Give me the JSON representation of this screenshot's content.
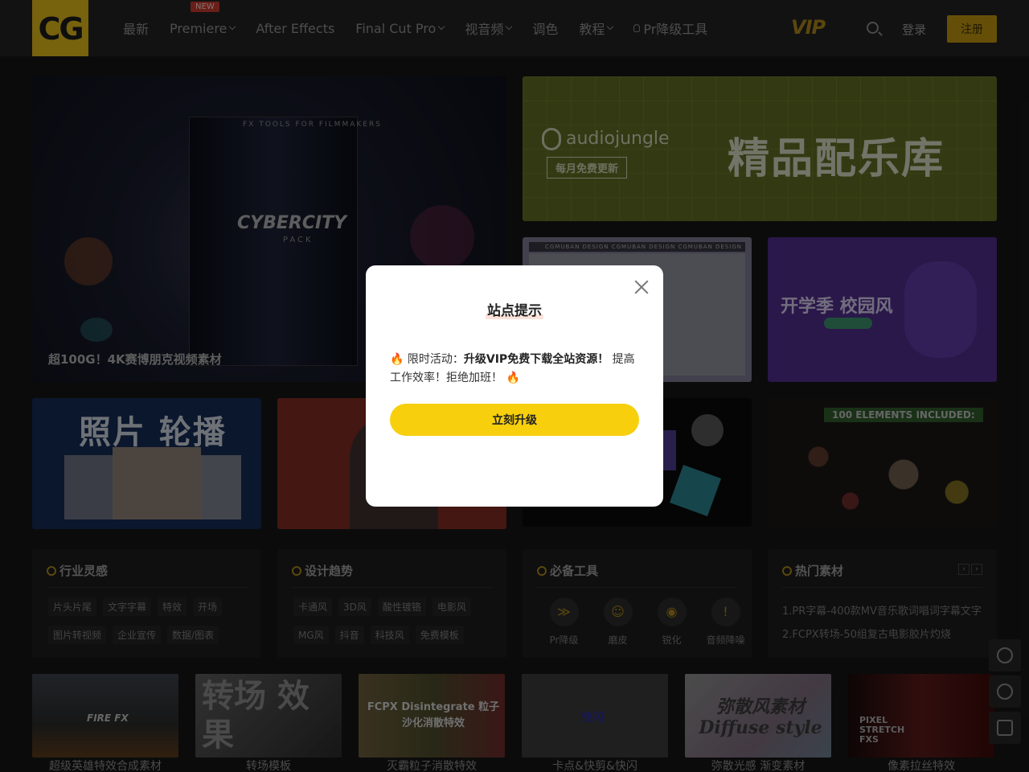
{
  "header": {
    "logo_text": "CG",
    "nav": [
      {
        "label": "最新",
        "dropdown": false
      },
      {
        "label": "Premiere",
        "dropdown": true,
        "badge": "NEW"
      },
      {
        "label": "After Effects",
        "dropdown": false
      },
      {
        "label": "Final Cut Pro",
        "dropdown": true
      },
      {
        "label": "视音频",
        "dropdown": true
      },
      {
        "label": "调色",
        "dropdown": false
      },
      {
        "label": "教程",
        "dropdown": true
      },
      {
        "label": "Pr降级工具",
        "dropdown": false
      }
    ],
    "vip_label": "VIP",
    "login_label": "登录",
    "register_label": "注册"
  },
  "banners": {
    "main_caption": "超100G！4K赛博朋克视频素材",
    "main_box_title": "CYBERCITY",
    "main_box_sub": "PACK",
    "main_box_top": "FX TOOLS FOR FILMMAKERS",
    "audio_brand": "audiojungle",
    "audio_sub": "每月免费更新",
    "audio_title": "精品配乐库",
    "design_strip": "CGMUBAN DESIGN  CGMUBAN DESIGN  CGMUBAN DESIGN",
    "campus_title": "开学季 校园风",
    "photo_title": "照片 轮播",
    "elements_tag": "100 ELEMENTS INCLUDED:"
  },
  "cards": {
    "industry": {
      "title": "行业灵感",
      "tags": [
        "片头片尾",
        "文字字幕",
        "特效",
        "开场",
        "图片转视频",
        "企业宣传",
        "数据/图表"
      ]
    },
    "trends": {
      "title": "设计趋势",
      "tags": [
        "卡通风",
        "3D风",
        "酸性镀铬",
        "电影风",
        "MG风",
        "抖音",
        "科技风",
        "免费模板"
      ]
    },
    "tools": {
      "title": "必备工具",
      "items": [
        {
          "label": "Pr降级",
          "icon": "chevrons-down-icon",
          "glyph": "≫"
        },
        {
          "label": "磨皮",
          "icon": "smile-icon",
          "glyph": "☺"
        },
        {
          "label": "锐化",
          "icon": "eye-icon",
          "glyph": "◉"
        },
        {
          "label": "音频降噪",
          "icon": "alert-icon",
          "glyph": "!"
        }
      ]
    },
    "hot": {
      "title": "热门素材",
      "items": [
        "1.PR字幕-400款MV音乐歌词唱词字幕文字",
        "2.FCPX转场-50组复古电影胶片灼烧"
      ]
    }
  },
  "thumbs": [
    {
      "caption": "超级英雄特效合成素材",
      "overlay": "FIRE FX"
    },
    {
      "caption": "转场模板",
      "overlay": "转场 效果"
    },
    {
      "caption": "灭霸粒子消散特效",
      "overlay": "FCPX Disintegrate 粒子沙化消散特效"
    },
    {
      "caption": "卡点&快剪&快闪",
      "overlay": "快闪"
    },
    {
      "caption": "弥散光感 渐变素材",
      "overlay": "弥散风素材 Diffuse style"
    },
    {
      "caption": "像素拉丝特效",
      "overlay": "PIXEL STRETCH FXS"
    }
  ],
  "modal": {
    "title": "站点提示",
    "body_prefix": "🔥 限时活动：",
    "body_bold": "升级VIP免费下载全站资源！",
    "body_suffix": " 提高工作效率！拒绝加班！ 🔥",
    "cta_label": "立刻升级"
  }
}
